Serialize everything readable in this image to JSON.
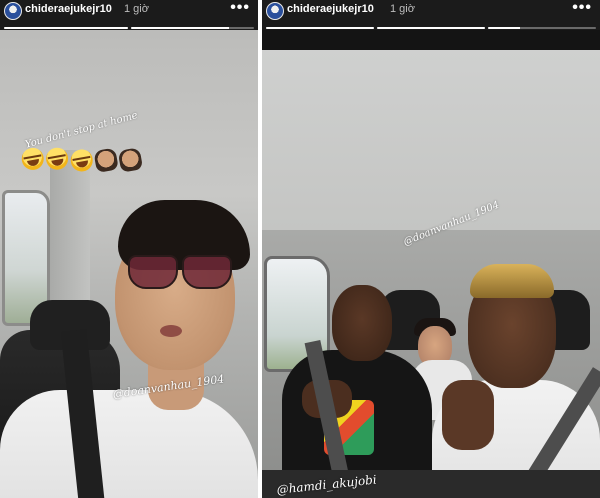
{
  "stories": [
    {
      "username": "chideraejukejr10",
      "time": "1 giờ",
      "more_label": "•••",
      "progress": [
        1.0,
        0.8,
        0
      ],
      "caption": "You don't stop at home",
      "emojis": [
        "laughing-emoji",
        "laughing-emoji",
        "laughing-emoji",
        "person-emoji",
        "person-emoji"
      ],
      "mention": "@doanvanhau_1904"
    },
    {
      "username": "chideraejukejr10",
      "time": "1 giờ",
      "more_label": "•••",
      "progress": [
        1.0,
        1.0,
        0.3
      ],
      "mentions": [
        "@doanvanhau_1904",
        "@hamdi_akujobi"
      ]
    }
  ]
}
